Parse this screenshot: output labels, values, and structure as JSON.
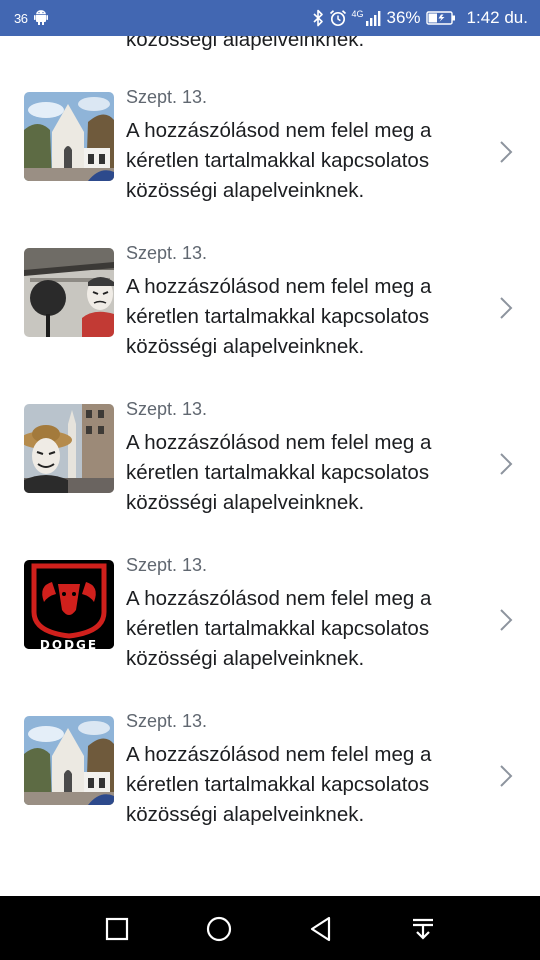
{
  "status_bar": {
    "notification_count": "36",
    "network_type": "4G",
    "battery_percent": "36%",
    "time": "1:42 du."
  },
  "partial_item": {
    "message_tail": "közösségi alapelveinknek."
  },
  "notifications": [
    {
      "thumbnail": "building-photo",
      "date": "Szept. 13.",
      "message": "A hozzászólásod nem felel meg a\nkéretlen tartalmakkal kapcsolatos\nközösségi alapelveinknek."
    },
    {
      "thumbnail": "mask-selfie-photo",
      "date": "Szept. 13.",
      "message": "A hozzászólásod nem felel meg a\nkéretlen tartalmakkal kapcsolatos\nközösségi alapelveinknek."
    },
    {
      "thumbnail": "mask-street-photo",
      "date": "Szept. 13.",
      "message": "A hozzászólásod nem felel meg a\nkéretlen tartalmakkal kapcsolatos\nközösségi alapelveinknek."
    },
    {
      "thumbnail": "dodge-logo",
      "brand_text": "DODGE",
      "date": "Szept. 13.",
      "message": "A hozzászólásod nem felel meg a\nkéretlen tartalmakkal kapcsolatos\nközösségi alapelveinknek."
    },
    {
      "thumbnail": "building-photo",
      "date": "Szept. 13.",
      "message": "A hozzászólásod nem felel meg a\nkéretlen tartalmakkal kapcsolatos\nközösségi alapelveinknek."
    }
  ],
  "navigation_bar": {
    "buttons": [
      "recents-square-icon",
      "home-circle-icon",
      "back-triangle-icon",
      "notification-pull-down-icon"
    ]
  },
  "colors": {
    "status_bar": "#4267b2",
    "primary_text": "#1c1e21",
    "secondary_text": "#606770",
    "chevron": "#8d949e",
    "nav_bar": "#000000"
  }
}
